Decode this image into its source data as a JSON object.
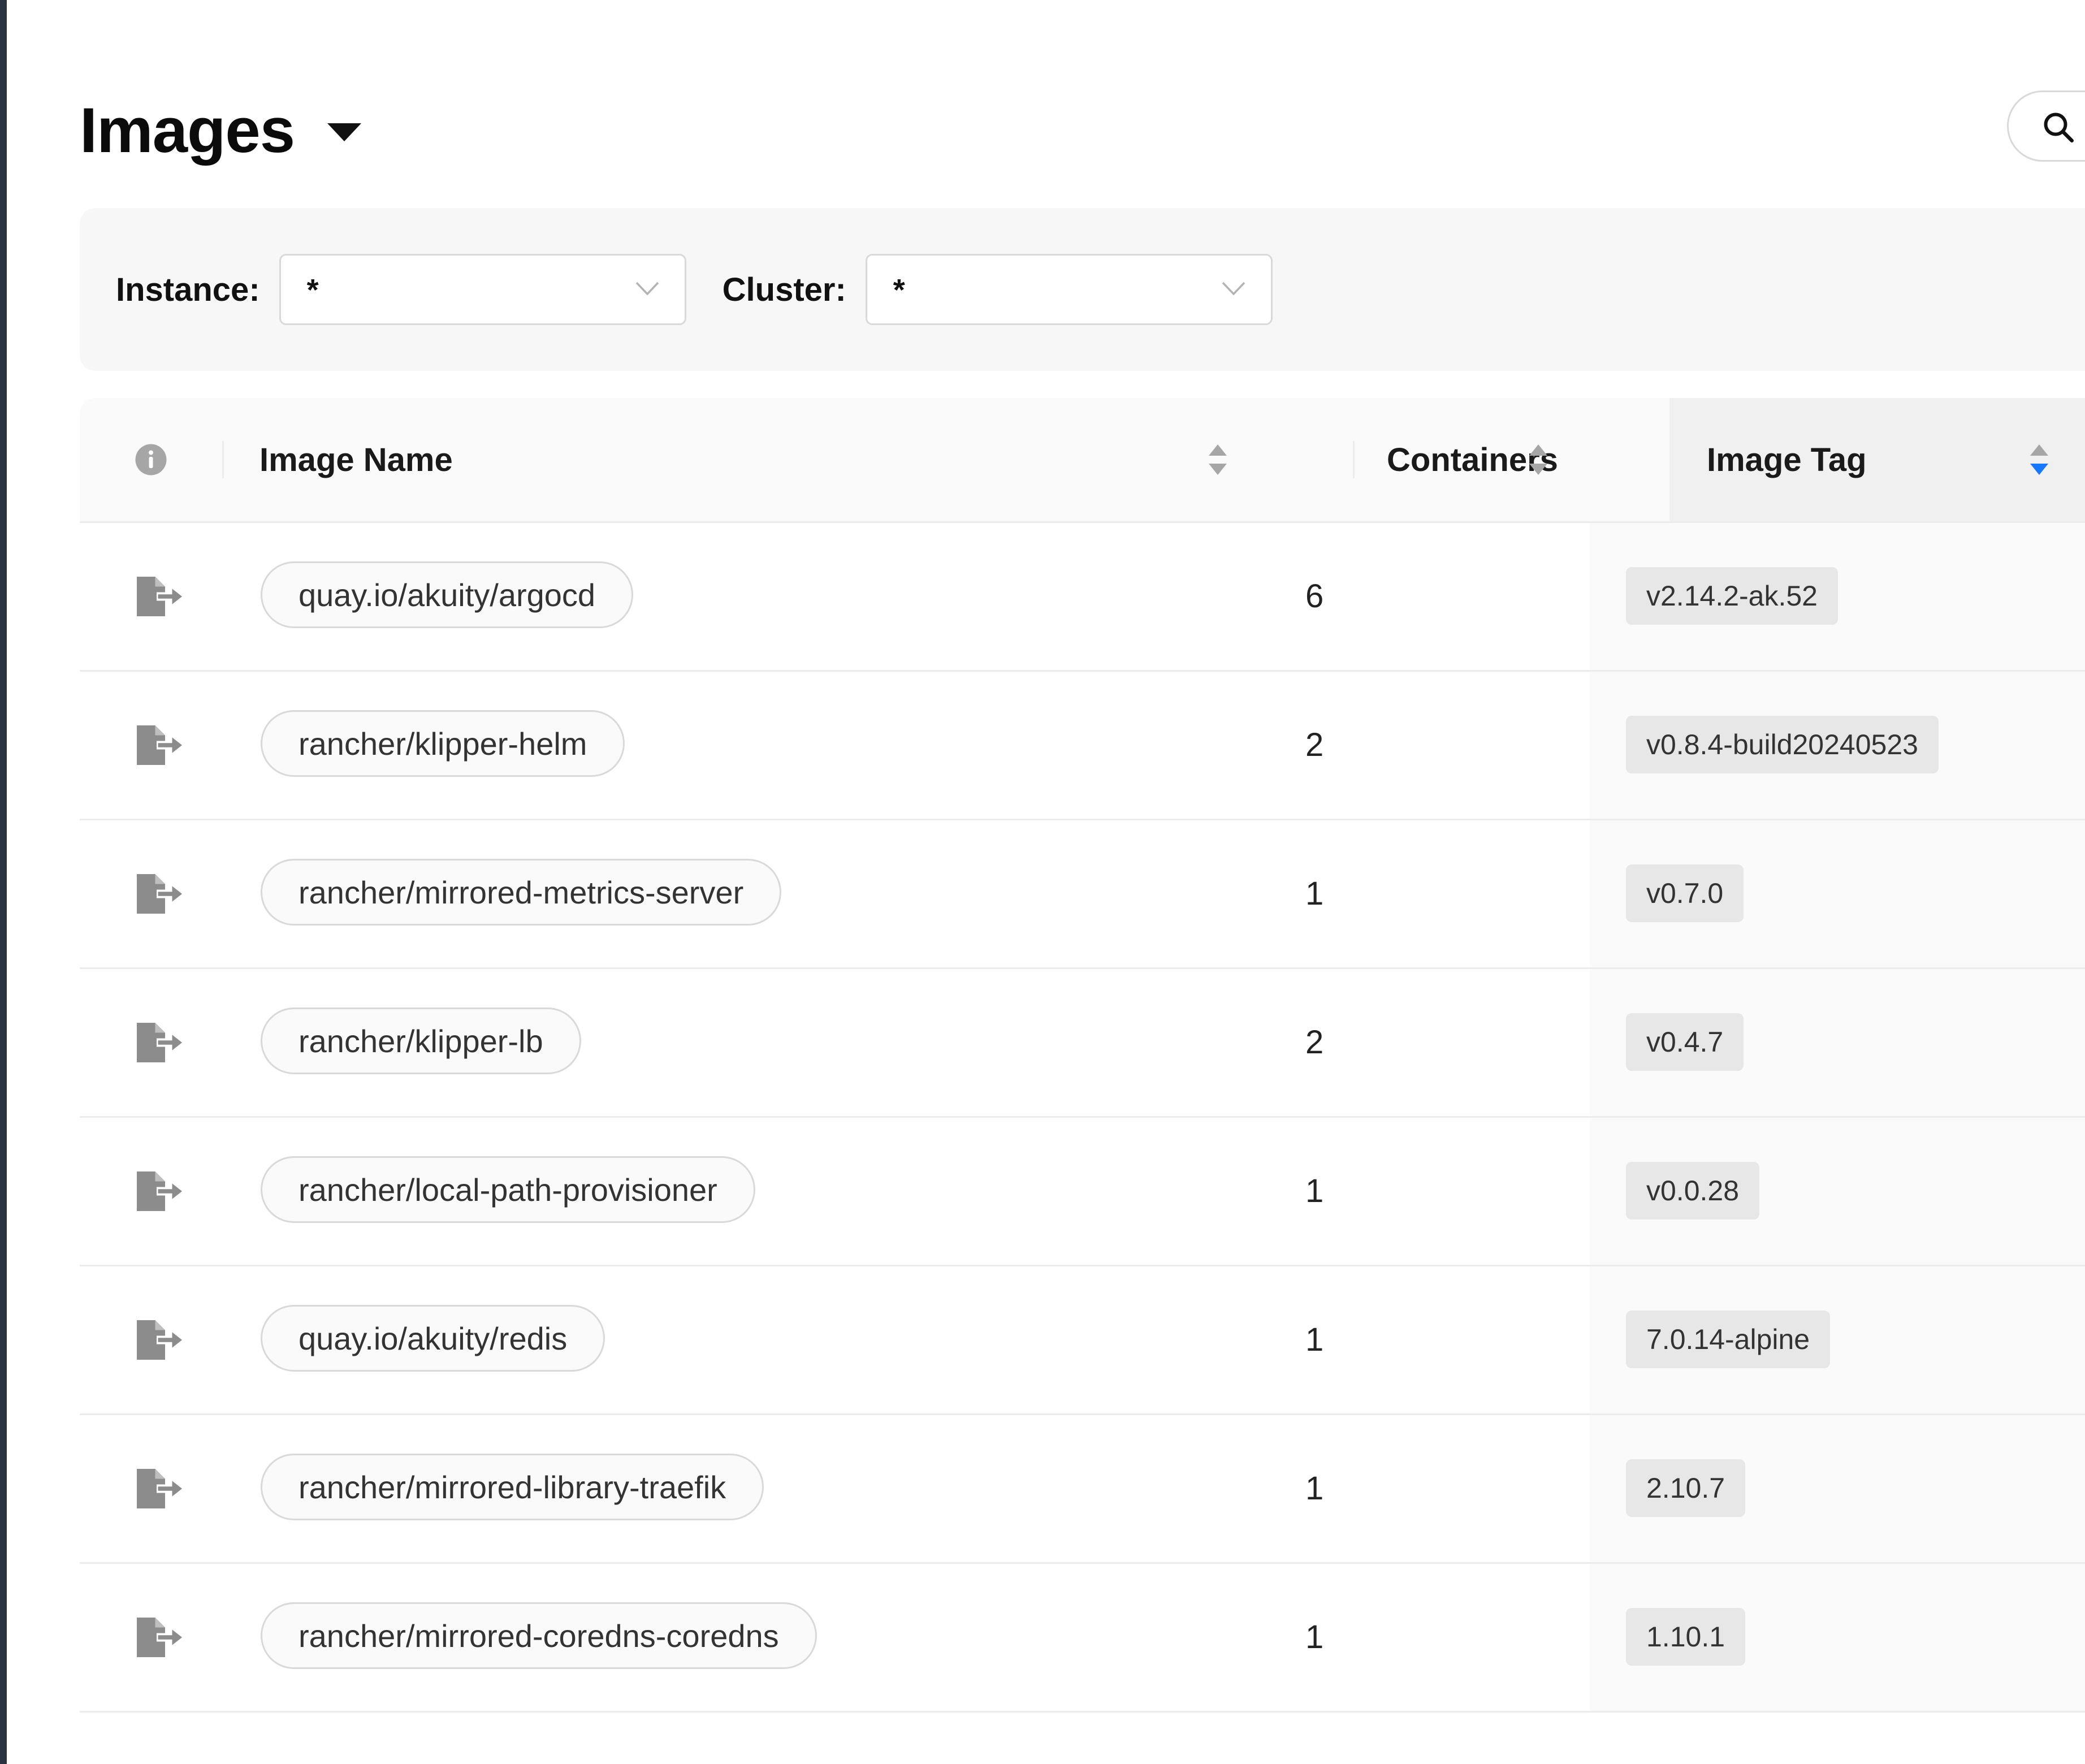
{
  "header": {
    "title": "Images",
    "title_menu_icon": "caret-down-icon",
    "search_icon": "search-icon"
  },
  "filters": {
    "instance_label": "Instance:",
    "instance_value": "*",
    "cluster_label": "Cluster:",
    "cluster_value": "*"
  },
  "table": {
    "columns": {
      "info_icon": "info-icon",
      "image_name": "Image Name",
      "containers": "Containers",
      "image_tag": "Image Tag"
    },
    "sort": {
      "column": "image_tag",
      "direction": "descending"
    },
    "rows": [
      {
        "image_name": "quay.io/akuity/argocd",
        "containers": "6",
        "image_tag": "v2.14.2-ak.52"
      },
      {
        "image_name": "rancher/klipper-helm",
        "containers": "2",
        "image_tag": "v0.8.4-build20240523"
      },
      {
        "image_name": "rancher/mirrored-metrics-server",
        "containers": "1",
        "image_tag": "v0.7.0"
      },
      {
        "image_name": "rancher/klipper-lb",
        "containers": "2",
        "image_tag": "v0.4.7"
      },
      {
        "image_name": "rancher/local-path-provisioner",
        "containers": "1",
        "image_tag": "v0.0.28"
      },
      {
        "image_name": "quay.io/akuity/redis",
        "containers": "1",
        "image_tag": "7.0.14-alpine"
      },
      {
        "image_name": "rancher/mirrored-library-traefik",
        "containers": "1",
        "image_tag": "2.10.7"
      },
      {
        "image_name": "rancher/mirrored-coredns-coredns",
        "containers": "1",
        "image_tag": "1.10.1"
      }
    ],
    "row_icon": "export-file-icon"
  },
  "colors": {
    "sort_active": "#1677ff",
    "sort_inactive": "#a6a6a6",
    "icon_gray": "#8c8c8c"
  }
}
